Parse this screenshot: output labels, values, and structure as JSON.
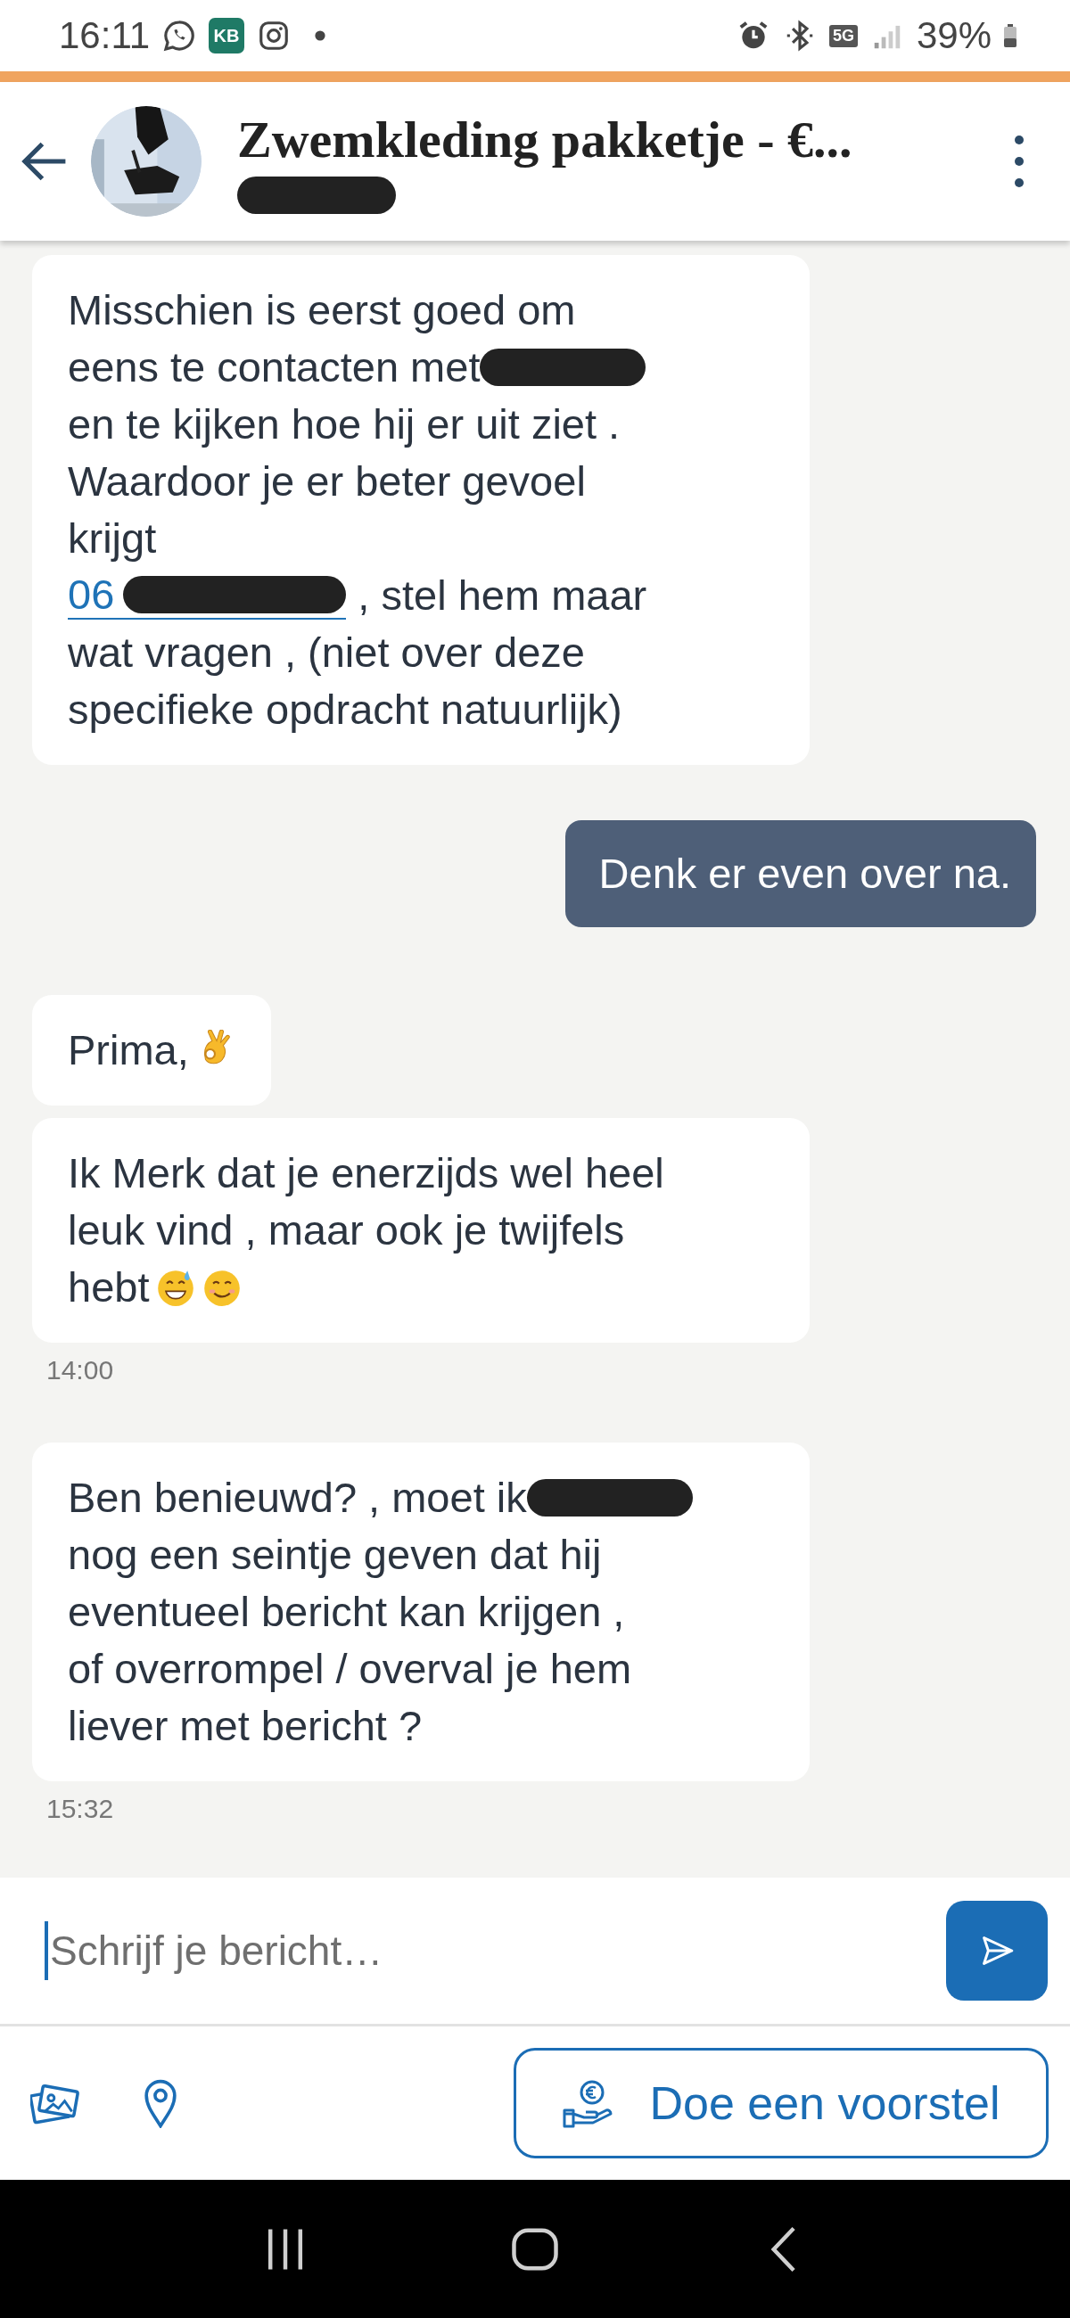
{
  "status_bar": {
    "time": "16:11",
    "app_badge": "KB",
    "network": "5G",
    "battery": "39%"
  },
  "header": {
    "title": "Zwemkleding pakketje - €..."
  },
  "messages": [
    {
      "kind": "received",
      "lines": [
        [
          {
            "kind": "text",
            "text": "Misschien is eerst goed om"
          }
        ],
        [
          {
            "kind": "text",
            "text": "eens te contacten met"
          },
          {
            "kind": "redacted"
          }
        ],
        [
          {
            "kind": "text",
            "text": "en te kijken hoe hij er uit ziet ."
          }
        ],
        [
          {
            "kind": "text",
            "text": "Waardoor je er beter gevoel"
          }
        ],
        [
          {
            "kind": "text",
            "text": "krijgt"
          }
        ],
        [
          {
            "kind": "link",
            "text": "06",
            "redacted": true
          },
          {
            "kind": "text",
            "text": " , stel hem maar"
          }
        ],
        [
          {
            "kind": "text",
            "text": "wat vragen , (niet over deze"
          }
        ],
        [
          {
            "kind": "text",
            "text": "specifieke opdracht natuurlijk)"
          }
        ]
      ]
    },
    {
      "kind": "sent",
      "lines": [
        [
          {
            "kind": "text",
            "text": "Denk er even over na."
          }
        ]
      ]
    },
    {
      "kind": "received",
      "lines": [
        [
          {
            "kind": "text",
            "text": "Prima,"
          },
          {
            "kind": "ok-hand"
          }
        ]
      ]
    },
    {
      "kind": "received",
      "time": "14:00",
      "lines": [
        [
          {
            "kind": "text",
            "text": "Ik Merk dat je enerzijds wel heel"
          }
        ],
        [
          {
            "kind": "text",
            "text": "leuk vind , maar ook je twijfels"
          }
        ],
        [
          {
            "kind": "text",
            "text": "hebt"
          },
          {
            "kind": "sweat-smile"
          },
          {
            "kind": "smile"
          }
        ]
      ]
    },
    {
      "kind": "received",
      "time": "15:32",
      "lines": [
        [
          {
            "kind": "text",
            "text": "Ben benieuwd? , moet ik"
          },
          {
            "kind": "redacted"
          }
        ],
        [
          {
            "kind": "text",
            "text": "nog een seintje geven dat hij"
          }
        ],
        [
          {
            "kind": "text",
            "text": "eventueel bericht kan krijgen ,"
          }
        ],
        [
          {
            "kind": "text",
            "text": "of overrompel / overval je hem"
          }
        ],
        [
          {
            "kind": "text",
            "text": "liever met bericht ?"
          }
        ]
      ]
    }
  ],
  "composer": {
    "placeholder": "Schrijf je bericht…"
  },
  "offer_button": "Doe een voorstel"
}
